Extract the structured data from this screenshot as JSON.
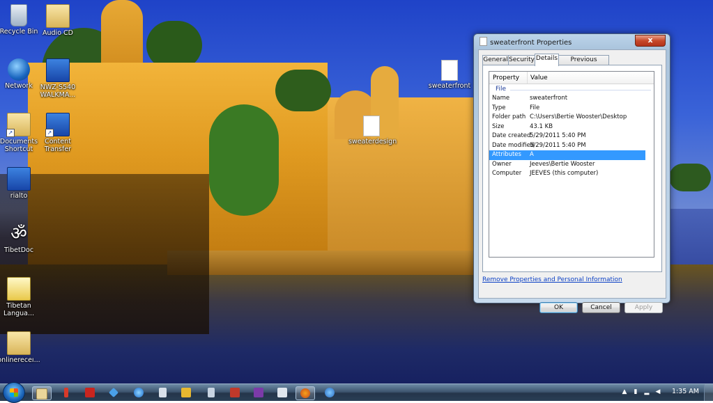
{
  "desktop": {
    "icons": [
      {
        "label": "Recycle Bin",
        "icon": "recycle-bin-icon"
      },
      {
        "label": "Audio CD",
        "icon": "folder-icon"
      },
      {
        "label": "Network",
        "icon": "network-icon"
      },
      {
        "label": "NWZ-S540 WALKMA...",
        "icon": "device-icon"
      },
      {
        "label": "Documents Shortcut",
        "icon": "folder-shortcut-icon"
      },
      {
        "label": "Content Transfer",
        "icon": "content-transfer-icon"
      },
      {
        "label": "rialto",
        "icon": "remote-desktop-icon"
      },
      {
        "label": "TibetDoc",
        "icon": "om-icon"
      },
      {
        "label": "Tibetan Langua...",
        "icon": "globe-book-icon"
      },
      {
        "label": "onlinereceı...",
        "icon": "folder-icon"
      },
      {
        "label": "sweaterfront",
        "icon": "file-icon"
      },
      {
        "label": "sweaterdesign",
        "icon": "file-icon"
      }
    ]
  },
  "dialog": {
    "title": "sweaterfront Properties",
    "close": "x",
    "tabs": [
      "General",
      "Security",
      "Details",
      "Previous Versions"
    ],
    "active_tab": "Details",
    "columns": {
      "property": "Property",
      "value": "Value"
    },
    "group": "File",
    "rows": [
      {
        "k": "Name",
        "v": "sweaterfront"
      },
      {
        "k": "Type",
        "v": "File"
      },
      {
        "k": "Folder path",
        "v": "C:\\Users\\Bertie Wooster\\Desktop"
      },
      {
        "k": "Size",
        "v": "43.1 KB"
      },
      {
        "k": "Date created",
        "v": "5/29/2011 5:40 PM"
      },
      {
        "k": "Date modified",
        "v": "5/29/2011 5:40 PM"
      },
      {
        "k": "Attributes",
        "v": "A"
      },
      {
        "k": "Owner",
        "v": "Jeeves\\Bertie Wooster"
      },
      {
        "k": "Computer",
        "v": "JEEVES (this computer)"
      }
    ],
    "selected_row": "Attributes",
    "link": "Remove Properties and Personal Information",
    "buttons": {
      "ok": "OK",
      "cancel": "Cancel",
      "apply": "Apply"
    }
  },
  "taskbar": {
    "clock": "1:35 AM",
    "pinned": [
      "explorer-icon",
      "pin-icon",
      "pdf-icon",
      "dropbox-icon",
      "ie-icon",
      "document-icon",
      "media-player-icon",
      "notepad-icon",
      "calendar-icon",
      "onenote-icon",
      "paint-icon",
      "firefox-icon",
      "network-share-icon"
    ],
    "active": "firefox-icon"
  }
}
